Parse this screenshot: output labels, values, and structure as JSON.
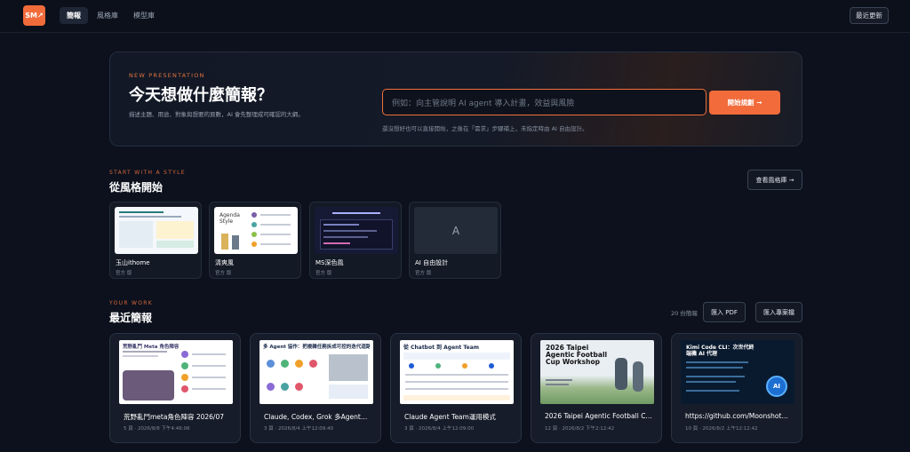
{
  "topbar": {
    "logo_text": "SM↗",
    "tabs": [
      "簡報",
      "風格庫",
      "模型庫"
    ],
    "active_tab": "簡報",
    "updates_button": "最近更新"
  },
  "hero": {
    "eyebrow": "NEW PRESENTATION",
    "title": "今天想做什麼簡報？",
    "subtitle": "描述主題、用途、對象與想要的頁數，AI 會先整理成可確認的大綱。",
    "input_placeholder": "例如：向主管說明 AI agent 導入計畫，效益與風險",
    "start_button": "開始規劃 →",
    "hint": "還沒想好也可以直接開始，之後在「需求」步驟補上，未指定時由 AI 自由設計。"
  },
  "styles_section": {
    "eyebrow": "START WITH A STYLE",
    "title": "從風格開始",
    "view_library_button": "查看風格庫 →",
    "cards": [
      {
        "name": "玉山ithome",
        "meta": "官方 版"
      },
      {
        "name": "清爽風",
        "meta": "官方 版"
      },
      {
        "name": "MS深色風",
        "meta": "官方 版"
      },
      {
        "name": "AI 自由設計",
        "meta": "官方 版",
        "placeholder_letter": "A"
      }
    ]
  },
  "work_section": {
    "eyebrow": "YOUR WORK",
    "title": "最近簡報",
    "count": "20 份簡報",
    "import_pdf_button": "匯入 PDF",
    "import_project_button": "匯入專案檔",
    "projects": [
      {
        "title": "荒野亂鬥meta角色陣容 2026/07",
        "meta": "5 頁 · 2026/8/8 下午4:46:06",
        "thumb_heading": "荒野亂鬥 Meta 角色陣容"
      },
      {
        "title": "Claude, Codex, Grok 多Agent…",
        "meta": "3 頁 · 2026/8/4 上午12:09:40",
        "thumb_heading": "多 Agent 協作：把複雜任務拆成可控的迭代迴路"
      },
      {
        "title": "Claude Agent Team運用模式",
        "meta": "3 頁 · 2026/8/4 上午12:09:00",
        "thumb_heading": "從 Chatbot 到 Agent Team"
      },
      {
        "title": "2026 Taipei Agentic Football C…",
        "meta": "12 頁 · 2026/8/2 下午2:12:42",
        "thumb_heading": "2026 Taipei Agentic Football Cup Workshop"
      },
      {
        "title": "https://github.com/Moonshot…",
        "meta": "10 頁 · 2026/8/2 上午12:12:42",
        "thumb_heading": "Kimi Code CLI：次世代終端機 AI 代理"
      }
    ]
  }
}
